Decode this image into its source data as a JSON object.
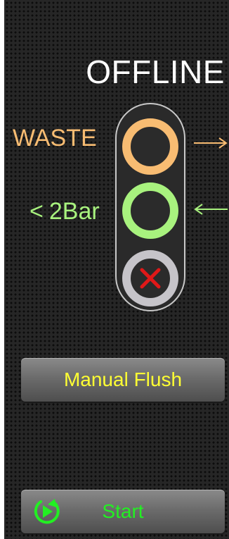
{
  "status": {
    "label": "OFFLINE"
  },
  "indicators": {
    "waste": {
      "label": "WASTE",
      "color": "#f8bc72",
      "arrow": "outgoing"
    },
    "pressure": {
      "prefix": "<",
      "label": "2Bar",
      "color": "#a8f27e",
      "arrow": "incoming"
    },
    "fault": {
      "ring_color": "#c6c4c9",
      "icon": "cross-icon",
      "icon_color": "#e01818"
    }
  },
  "buttons": {
    "manual_flush": {
      "label": "Manual Flush",
      "color": "#ffff33"
    },
    "start": {
      "label": "Start",
      "icon": "start-cycle-icon",
      "color": "#22f022"
    }
  }
}
